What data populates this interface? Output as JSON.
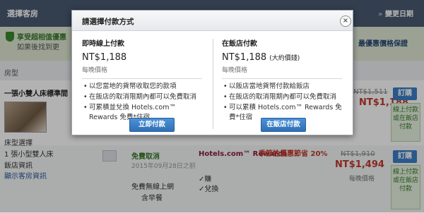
{
  "background": {
    "header_title": "選擇客房",
    "change_dates": "變更日期",
    "notice_line1": "享受超相值優惠",
    "notice_line2": "如果後找到更",
    "price_guarantee": "最優惠價格保證",
    "column_room": "房型",
    "room1": {
      "name": "一張小雙人床標準間",
      "old_price": "NT$1,511",
      "new_price": "NT$1,188"
    },
    "room_info": [
      "床型選擇",
      "1 張小型雙人床",
      "飯店資訊",
      "顯示客房資訊"
    ],
    "book_label": "訂購",
    "side_note": "線上付款或在飯店付款",
    "row2": {
      "free_cancel": "免費取消",
      "free_date": "2015年09月28日之前",
      "free_wifi": "免費無線上網",
      "tax": "含早餐",
      "rewards": "Hotels.com™ Rewards",
      "rewards_check1": "✓賺",
      "rewards_check2": "✓兌換",
      "seasonal": "季節性優惠節省 20%",
      "old_price": "NT$1,910",
      "new_price": "NT$1,494",
      "per_night": "每晚價格"
    }
  },
  "modal": {
    "title": "請選擇付款方式",
    "close": "×",
    "left": {
      "title": "即時線上付款",
      "price": "NT$1,188",
      "price_note": "每晚價格",
      "bullets": [
        "以您當地的貨幣收取您的款項",
        "在飯店的取消限期內都可以免費取消",
        "可累積並兌換 Hotels.com™ Rewards 免費*住宿"
      ],
      "button": "立即付款"
    },
    "right": {
      "title": "在飯店付款",
      "price": "NT$1,188",
      "price_approx": "(大約價錢)",
      "price_note": "每晚價格",
      "bullets": [
        "以飯店當地貨幣付款給飯店",
        "在飯店的取消限期內都可以免費取消",
        "可以累積 Hotels.com™ Rewards 免費*住宿"
      ],
      "button": "在飯店付款"
    }
  }
}
